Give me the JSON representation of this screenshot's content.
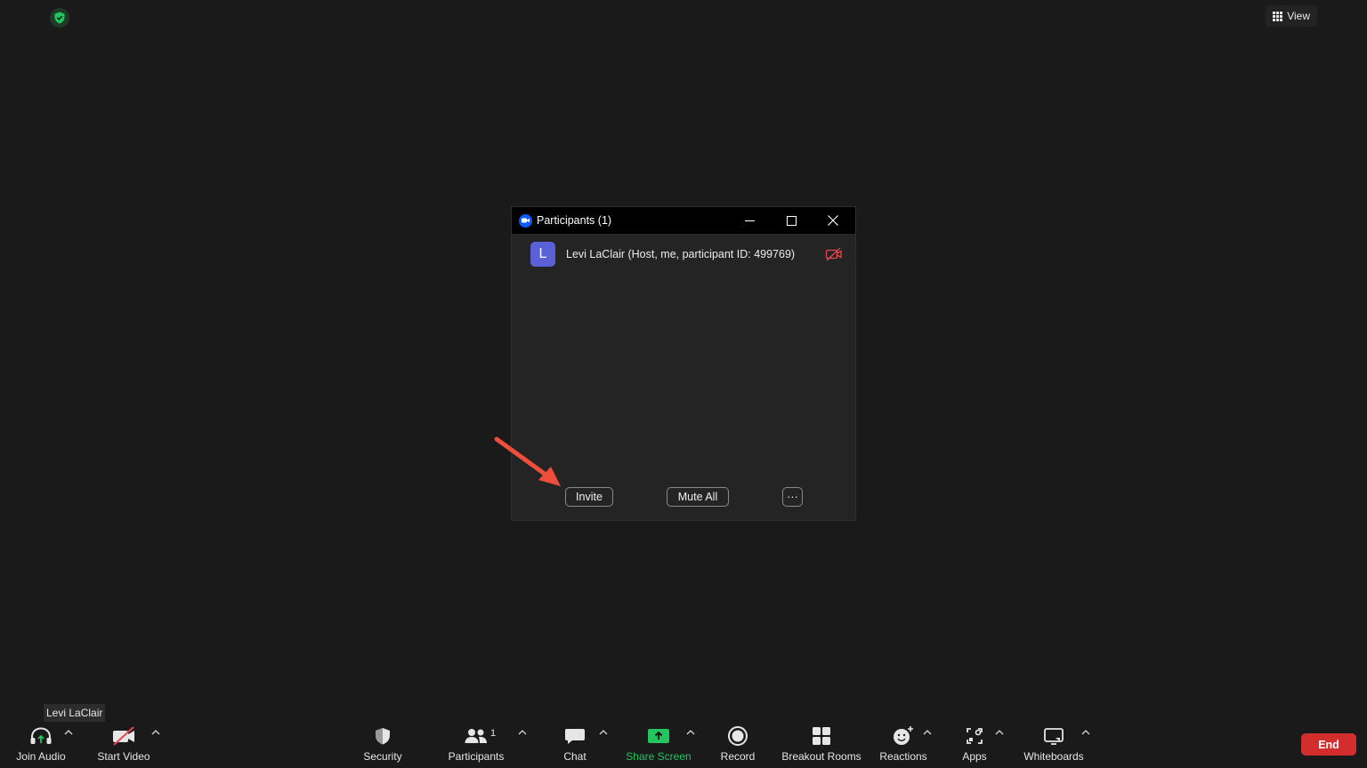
{
  "view": {
    "label": "View"
  },
  "participants_window": {
    "title": "Participants (1)",
    "participant": {
      "avatar_letter": "L",
      "name": "Levi LaClair (Host, me, participant ID: 499769)"
    },
    "buttons": {
      "invite": "Invite",
      "mute_all": "Mute All",
      "more": "···"
    }
  },
  "tooltip": {
    "text": "Levi LaClair"
  },
  "toolbar": {
    "join_audio": "Join Audio",
    "start_video": "Start Video",
    "security": "Security",
    "participants": "Participants",
    "participants_count": "1",
    "chat": "Chat",
    "share_screen": "Share Screen",
    "record": "Record",
    "breakout_rooms": "Breakout Rooms",
    "reactions": "Reactions",
    "apps": "Apps",
    "whiteboards": "Whiteboards",
    "end": "End"
  },
  "colors": {
    "background": "#1a1a1a",
    "share_green": "#22c55e",
    "end_red": "#d32e2e",
    "avatar": "#5a60d6",
    "arrow": "#ee4e3a"
  }
}
